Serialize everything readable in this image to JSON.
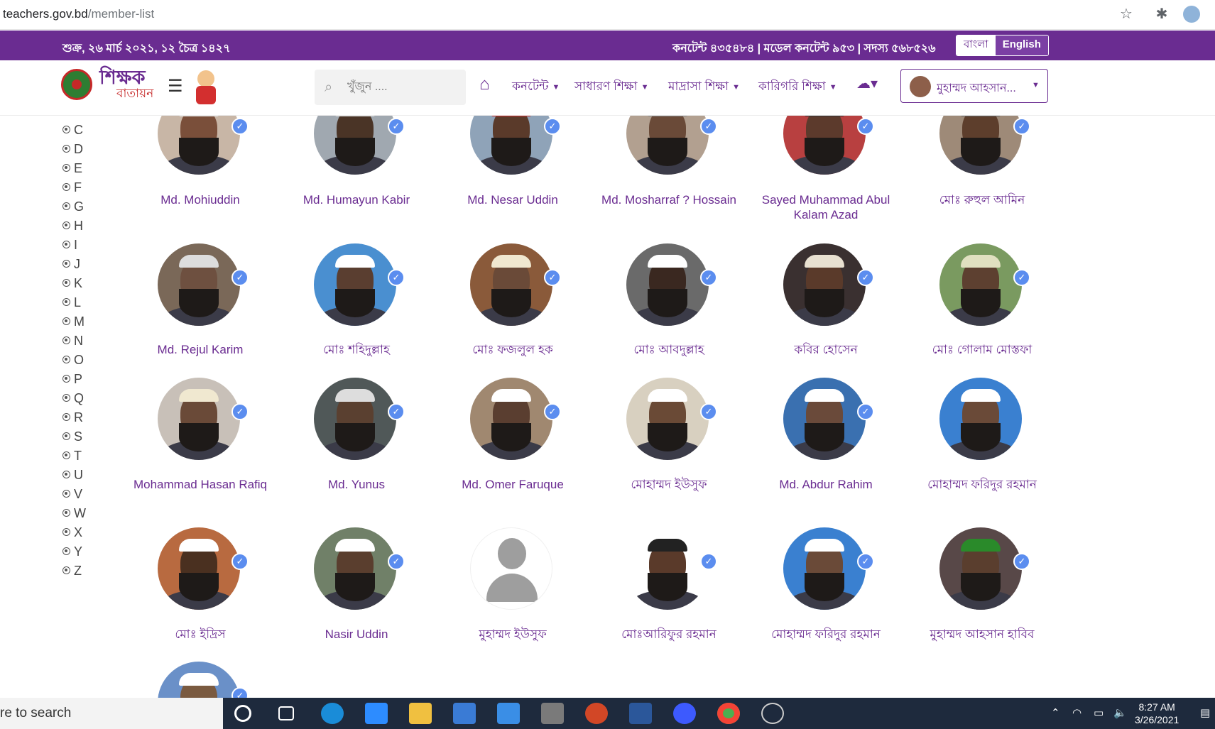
{
  "browser": {
    "url_host": "teachers.gov.bd",
    "url_path": "/member-list"
  },
  "topbar": {
    "date": "শুক্র, ২৬ মার্চ ২০২১, ১২ চৈত্র ১৪২৭",
    "stats": "কনটেন্ট ৪৩৫৪৮৪ | মডেল কনটেন্ট ৯৫৩ | সদস্য ৫৬৮৫২৬",
    "lang_bn": "বাংলা",
    "lang_en": "English"
  },
  "nav": {
    "brand_top": "শিক্ষক",
    "brand_bottom": "বাতায়ন",
    "search_placeholder": "খুঁজুন ....",
    "menus": [
      "কনটেন্ট",
      "সাধারণ শিক্ষা",
      "মাদ্রাসা শিক্ষা",
      "কারিগরি শিক্ষা"
    ],
    "user_name": "মুহাম্মদ আহসান..."
  },
  "alphabet": [
    "C",
    "D",
    "E",
    "F",
    "G",
    "H",
    "I",
    "J",
    "K",
    "L",
    "M",
    "N",
    "O",
    "P",
    "Q",
    "R",
    "S",
    "T",
    "U",
    "V",
    "W",
    "X",
    "Y",
    "Z"
  ],
  "members": [
    {
      "name": "Md. Mohiuddin",
      "verified": true
    },
    {
      "name": "Md. Humayun Kabir",
      "verified": true
    },
    {
      "name": "Md. Nesar Uddin",
      "verified": true
    },
    {
      "name": "Md. Mosharraf ? Hossain",
      "verified": true
    },
    {
      "name": "Sayed Muhammad Abul Kalam Azad",
      "verified": true
    },
    {
      "name": "মোঃ রুহুল আমিন",
      "verified": true
    },
    {
      "name": "Md. Rejul Karim",
      "verified": true
    },
    {
      "name": "মোঃ শহিদুল্লাহ",
      "verified": true
    },
    {
      "name": "মোঃ ফজলুল হক",
      "verified": true
    },
    {
      "name": "মোঃ আবদুল্লাহ",
      "verified": true
    },
    {
      "name": "কবির হোসেন",
      "verified": true
    },
    {
      "name": "মোঃ গোলাম মোস্তফা",
      "verified": true
    },
    {
      "name": "Mohammad Hasan Rafiq",
      "verified": true
    },
    {
      "name": "Md. Yunus",
      "verified": true
    },
    {
      "name": "Md. Omer Faruque",
      "verified": true
    },
    {
      "name": "মোহাম্মদ ইউসুফ",
      "verified": true
    },
    {
      "name": "Md. Abdur Rahim",
      "verified": true
    },
    {
      "name": "মোহাম্মদ ফরিদুর রহমান",
      "verified": false
    },
    {
      "name": "মোঃ ইদ্রিস",
      "verified": true
    },
    {
      "name": "Nasir Uddin",
      "verified": true
    },
    {
      "name": "মুহাম্মদ ইউসুফ",
      "verified": false,
      "placeholder": true
    },
    {
      "name": "মোঃআরিফুর রহমান",
      "verified": true
    },
    {
      "name": "মোহাম্মদ ফরিদুর রহমান",
      "verified": true
    },
    {
      "name": "মুহাম্মদ আহসান হাবিব",
      "verified": true
    },
    {
      "name": "",
      "verified": true
    }
  ],
  "taskbar": {
    "search_text": "re to search",
    "time": "8:27 AM",
    "date": "3/26/2021"
  },
  "colors": {
    "brand_purple": "#6a2c91",
    "verified_blue": "#5b8def",
    "taskbar": "#1e2a3d"
  }
}
